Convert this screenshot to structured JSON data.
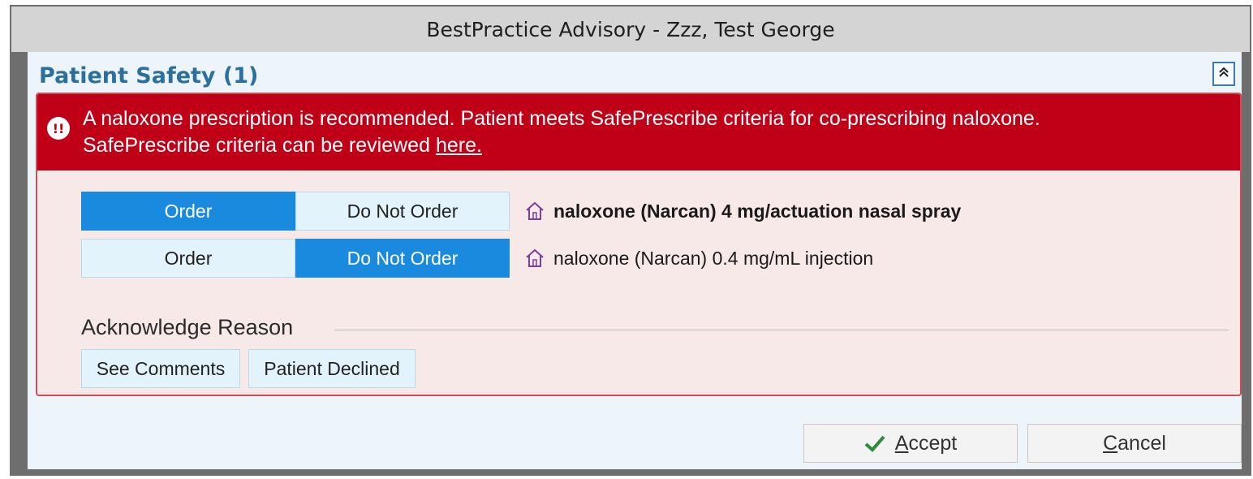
{
  "window": {
    "title": "BestPractice Advisory - Zzz, Test George"
  },
  "section": {
    "title": "Patient Safety (1)",
    "collapse_icon": "double-chevron-up-icon"
  },
  "alert": {
    "line1": "A naloxone prescription is recommended.  Patient meets SafePrescribe criteria for co-prescribing naloxone.",
    "line2_prefix": "SafePrescribe criteria can be reviewed ",
    "link_text": "here.",
    "icon": "double-exclamation-icon",
    "color": "#c00016"
  },
  "orders": [
    {
      "order_label": "Order",
      "do_not_order_label": "Do Not Order",
      "selected": "Order",
      "medication": "naloxone (Narcan) 4 mg/actuation nasal spray",
      "bold": true,
      "icon": "home-med-icon"
    },
    {
      "order_label": "Order",
      "do_not_order_label": "Do Not Order",
      "selected": "Do Not Order",
      "medication": "naloxone (Narcan) 0.4 mg/mL injection",
      "bold": false,
      "icon": "home-med-icon"
    }
  ],
  "acknowledge": {
    "title": "Acknowledge Reason",
    "reasons": [
      "See Comments",
      "Patient Declined"
    ]
  },
  "footer": {
    "accept_first": "A",
    "accept_rest": "ccept",
    "cancel_first": "C",
    "cancel_rest": "ancel",
    "accept_icon": "checkmark-icon"
  },
  "colors": {
    "selected": "#1a8adf",
    "unselected": "#e3f3fb",
    "accent": "#2a6f9e",
    "house_icon": "#7b3fa0",
    "check": "#2e8b3a"
  }
}
